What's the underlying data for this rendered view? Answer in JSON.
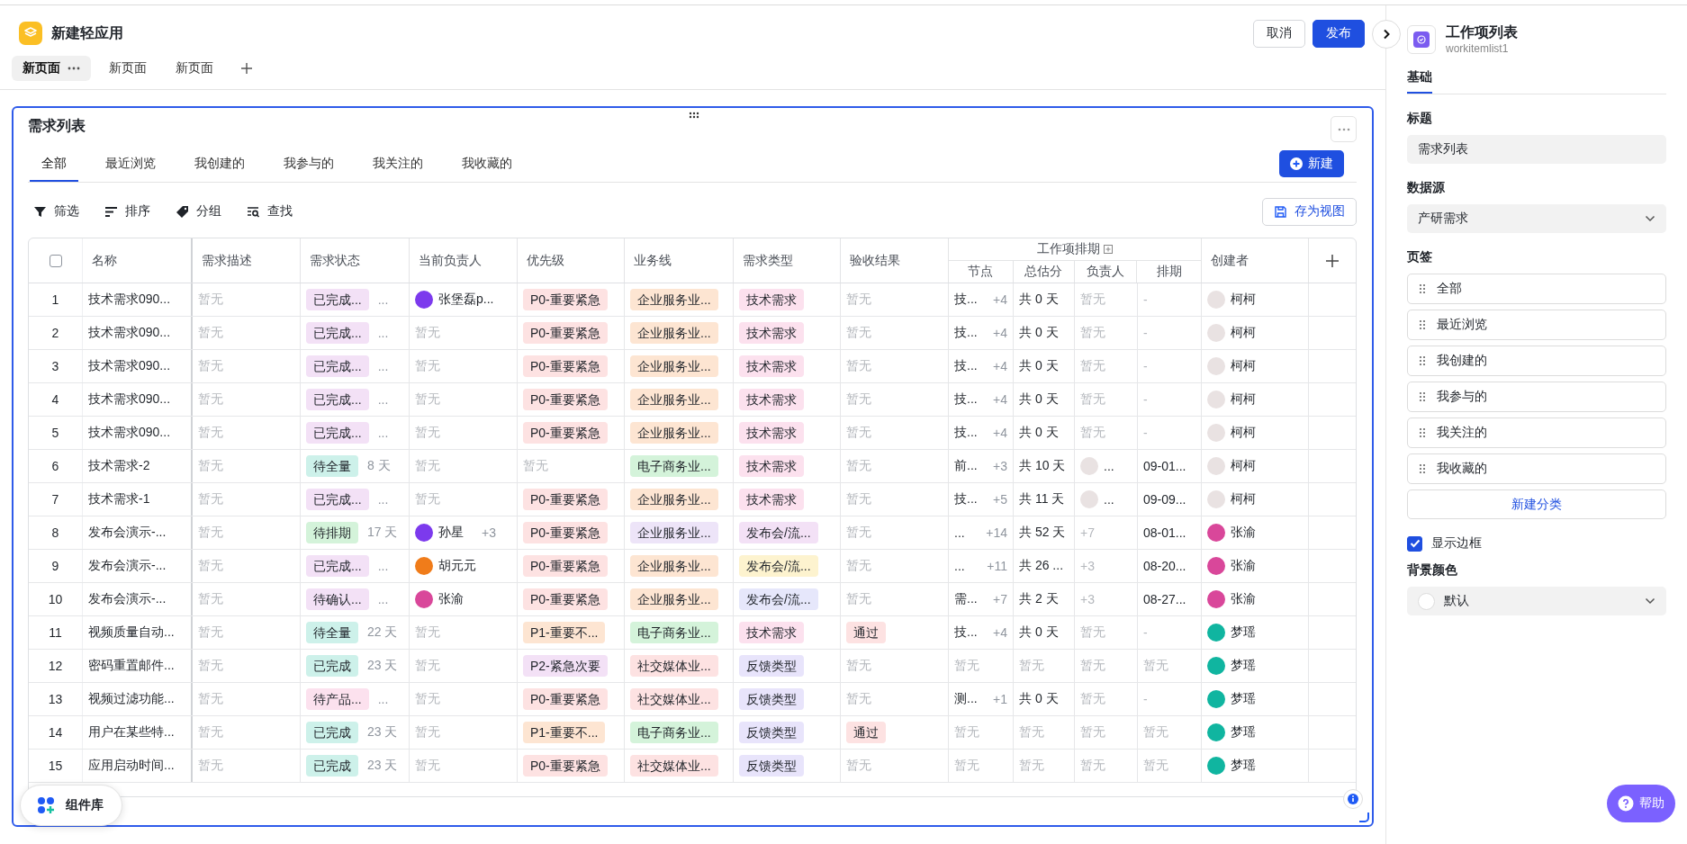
{
  "app": {
    "title": "新建轻应用"
  },
  "page_tabs": [
    {
      "label": "新页面",
      "selected": true
    },
    {
      "label": "新页面",
      "selected": false
    },
    {
      "label": "新页面",
      "selected": false
    }
  ],
  "header_buttons": [
    {
      "label": "取消",
      "kind": "secondary"
    },
    {
      "label": "发布",
      "kind": "primary"
    }
  ],
  "component": {
    "title": "需求列表",
    "tabs": [
      {
        "label": "全部",
        "selected": true
      },
      {
        "label": "最近浏览",
        "selected": false
      },
      {
        "label": "我创建的",
        "selected": false
      },
      {
        "label": "我参与的",
        "selected": false
      },
      {
        "label": "我关注的",
        "selected": false
      },
      {
        "label": "我收藏的",
        "selected": false
      }
    ],
    "new_button": "新建",
    "toolbar": [
      {
        "label": "筛选",
        "kind": "filter"
      },
      {
        "label": "排序",
        "kind": "sort"
      },
      {
        "label": "分组",
        "kind": "group"
      },
      {
        "label": "查找",
        "kind": "find"
      }
    ],
    "save_view_button": "存为视图",
    "table": {
      "columns": [
        {
          "kind": "select",
          "checked": false
        },
        {
          "label": "名称"
        },
        {
          "label": "需求描述"
        },
        {
          "label": "需求状态"
        },
        {
          "label": "当前负责人"
        },
        {
          "label": "优先级"
        },
        {
          "label": "业务线"
        },
        {
          "label": "需求类型"
        },
        {
          "label": "验收结果"
        },
        {
          "label": "节点"
        },
        {
          "label": "总估分"
        },
        {
          "label": "负责人"
        },
        {
          "label": "排期"
        },
        {
          "label": "创建者"
        }
      ],
      "column_groups": [
        {
          "label": "工作项排期"
        }
      ],
      "rows": [
        {
          "cells": [
            {
              "kind": "index",
              "text": "1"
            },
            {
              "kind": "text",
              "text": "技术需求090..."
            },
            {
              "kind": "muted",
              "text": "暂无"
            },
            {
              "kind": "tag",
              "text": "已完成...",
              "color": "#f3e1f6",
              "extra": "..."
            },
            {
              "kind": "person",
              "text": "张堡磊p...",
              "color": "#7c3aed"
            },
            {
              "kind": "tag",
              "text": "P0-重要紧急",
              "color": "#fde2e2"
            },
            {
              "kind": "tag",
              "text": "企业服务业...",
              "color": "#fde5d2"
            },
            {
              "kind": "tag",
              "text": "技术需求",
              "color": "#fce1ee"
            },
            {
              "kind": "muted",
              "text": "暂无"
            },
            {
              "kind": "text",
              "text": "技...",
              "extra": "+4"
            },
            {
              "kind": "text",
              "text": "共 0 天"
            },
            {
              "kind": "muted",
              "text": "暂无"
            },
            {
              "kind": "muted",
              "text": "-"
            },
            {
              "kind": "person",
              "text": "柯柯",
              "color": "#e9e2e2"
            }
          ]
        },
        {
          "cells": [
            {
              "kind": "index",
              "text": "2"
            },
            {
              "kind": "text",
              "text": "技术需求090..."
            },
            {
              "kind": "muted",
              "text": "暂无"
            },
            {
              "kind": "tag",
              "text": "已完成...",
              "color": "#f3e1f6",
              "extra": "..."
            },
            {
              "kind": "muted",
              "text": "暂无"
            },
            {
              "kind": "tag",
              "text": "P0-重要紧急",
              "color": "#fde2e2"
            },
            {
              "kind": "tag",
              "text": "企业服务业...",
              "color": "#fde5d2"
            },
            {
              "kind": "tag",
              "text": "技术需求",
              "color": "#fce1ee"
            },
            {
              "kind": "muted",
              "text": "暂无"
            },
            {
              "kind": "text",
              "text": "技...",
              "extra": "+4"
            },
            {
              "kind": "text",
              "text": "共 0 天"
            },
            {
              "kind": "muted",
              "text": "暂无"
            },
            {
              "kind": "muted",
              "text": "-"
            },
            {
              "kind": "person",
              "text": "柯柯",
              "color": "#e9e2e2"
            }
          ]
        },
        {
          "cells": [
            {
              "kind": "index",
              "text": "3"
            },
            {
              "kind": "text",
              "text": "技术需求090..."
            },
            {
              "kind": "muted",
              "text": "暂无"
            },
            {
              "kind": "tag",
              "text": "已完成...",
              "color": "#f3e1f6",
              "extra": "..."
            },
            {
              "kind": "muted",
              "text": "暂无"
            },
            {
              "kind": "tag",
              "text": "P0-重要紧急",
              "color": "#fde2e2"
            },
            {
              "kind": "tag",
              "text": "企业服务业...",
              "color": "#fde5d2"
            },
            {
              "kind": "tag",
              "text": "技术需求",
              "color": "#fce1ee"
            },
            {
              "kind": "muted",
              "text": "暂无"
            },
            {
              "kind": "text",
              "text": "技...",
              "extra": "+4"
            },
            {
              "kind": "text",
              "text": "共 0 天"
            },
            {
              "kind": "muted",
              "text": "暂无"
            },
            {
              "kind": "muted",
              "text": "-"
            },
            {
              "kind": "person",
              "text": "柯柯",
              "color": "#e9e2e2"
            }
          ]
        },
        {
          "cells": [
            {
              "kind": "index",
              "text": "4"
            },
            {
              "kind": "text",
              "text": "技术需求090..."
            },
            {
              "kind": "muted",
              "text": "暂无"
            },
            {
              "kind": "tag",
              "text": "已完成...",
              "color": "#f3e1f6",
              "extra": "..."
            },
            {
              "kind": "muted",
              "text": "暂无"
            },
            {
              "kind": "tag",
              "text": "P0-重要紧急",
              "color": "#fde2e2"
            },
            {
              "kind": "tag",
              "text": "企业服务业...",
              "color": "#fde5d2"
            },
            {
              "kind": "tag",
              "text": "技术需求",
              "color": "#fce1ee"
            },
            {
              "kind": "muted",
              "text": "暂无"
            },
            {
              "kind": "text",
              "text": "技...",
              "extra": "+4"
            },
            {
              "kind": "text",
              "text": "共 0 天"
            },
            {
              "kind": "muted",
              "text": "暂无"
            },
            {
              "kind": "muted",
              "text": "-"
            },
            {
              "kind": "person",
              "text": "柯柯",
              "color": "#e9e2e2"
            }
          ]
        },
        {
          "cells": [
            {
              "kind": "index",
              "text": "5"
            },
            {
              "kind": "text",
              "text": "技术需求090..."
            },
            {
              "kind": "muted",
              "text": "暂无"
            },
            {
              "kind": "tag",
              "text": "已完成...",
              "color": "#f3e1f6",
              "extra": "..."
            },
            {
              "kind": "muted",
              "text": "暂无"
            },
            {
              "kind": "tag",
              "text": "P0-重要紧急",
              "color": "#fde2e2"
            },
            {
              "kind": "tag",
              "text": "企业服务业...",
              "color": "#fde5d2"
            },
            {
              "kind": "tag",
              "text": "技术需求",
              "color": "#fce1ee"
            },
            {
              "kind": "muted",
              "text": "暂无"
            },
            {
              "kind": "text",
              "text": "技...",
              "extra": "+4"
            },
            {
              "kind": "text",
              "text": "共 0 天"
            },
            {
              "kind": "muted",
              "text": "暂无"
            },
            {
              "kind": "muted",
              "text": "-"
            },
            {
              "kind": "person",
              "text": "柯柯",
              "color": "#e9e2e2"
            }
          ]
        },
        {
          "cells": [
            {
              "kind": "index",
              "text": "6"
            },
            {
              "kind": "text",
              "text": "技术需求-2"
            },
            {
              "kind": "muted",
              "text": "暂无"
            },
            {
              "kind": "tag",
              "text": "待全量",
              "color": "#cdf1ea",
              "extra": "8 天"
            },
            {
              "kind": "muted",
              "text": "暂无"
            },
            {
              "kind": "muted",
              "text": "暂无"
            },
            {
              "kind": "tag",
              "text": "电子商务业...",
              "color": "#d4f3da"
            },
            {
              "kind": "tag",
              "text": "技术需求",
              "color": "#fce1ee"
            },
            {
              "kind": "muted",
              "text": "暂无"
            },
            {
              "kind": "text",
              "text": "前...",
              "extra": "+3"
            },
            {
              "kind": "text",
              "text": "共 10 天"
            },
            {
              "kind": "person",
              "text": "...",
              "color": "#e9e2e2"
            },
            {
              "kind": "text",
              "text": "09-01..."
            },
            {
              "kind": "person",
              "text": "柯柯",
              "color": "#e9e2e2"
            }
          ]
        },
        {
          "cells": [
            {
              "kind": "index",
              "text": "7"
            },
            {
              "kind": "text",
              "text": "技术需求-1"
            },
            {
              "kind": "muted",
              "text": "暂无"
            },
            {
              "kind": "tag",
              "text": "已完成...",
              "color": "#f3e1f6",
              "extra": "..."
            },
            {
              "kind": "muted",
              "text": "暂无"
            },
            {
              "kind": "tag",
              "text": "P0-重要紧急",
              "color": "#fde2e2"
            },
            {
              "kind": "tag",
              "text": "企业服务业...",
              "color": "#fde5d2"
            },
            {
              "kind": "tag",
              "text": "技术需求",
              "color": "#fce1ee"
            },
            {
              "kind": "muted",
              "text": "暂无"
            },
            {
              "kind": "text",
              "text": "技...",
              "extra": "+5"
            },
            {
              "kind": "text",
              "text": "共 11 天"
            },
            {
              "kind": "person",
              "text": "...",
              "color": "#e9e2e2"
            },
            {
              "kind": "text",
              "text": "09-09..."
            },
            {
              "kind": "person",
              "text": "柯柯",
              "color": "#e9e2e2"
            }
          ]
        },
        {
          "cells": [
            {
              "kind": "index",
              "text": "8"
            },
            {
              "kind": "text",
              "text": "发布会演示-..."
            },
            {
              "kind": "muted",
              "text": "暂无"
            },
            {
              "kind": "tag",
              "text": "待排期",
              "color": "#d4f3da",
              "extra": "17 天"
            },
            {
              "kind": "person",
              "text": "孙星",
              "color": "#7c3aed",
              "extra": "+3"
            },
            {
              "kind": "tag",
              "text": "P0-重要紧急",
              "color": "#fde2e2"
            },
            {
              "kind": "tag",
              "text": "企业服务业...",
              "color": "#ede4f8"
            },
            {
              "kind": "tag",
              "text": "发布会/流...",
              "color": "#f3e1f6"
            },
            {
              "kind": "muted",
              "text": "暂无"
            },
            {
              "kind": "text",
              "text": "...",
              "extra": "+14"
            },
            {
              "kind": "text",
              "text": "共 52 天"
            },
            {
              "kind": "muted",
              "text": "+7"
            },
            {
              "kind": "text",
              "text": "08-01..."
            },
            {
              "kind": "person",
              "text": "张渝",
              "color": "#d9479a"
            }
          ]
        },
        {
          "cells": [
            {
              "kind": "index",
              "text": "9"
            },
            {
              "kind": "text",
              "text": "发布会演示-..."
            },
            {
              "kind": "muted",
              "text": "暂无"
            },
            {
              "kind": "tag",
              "text": "已完成...",
              "color": "#f3e1f6",
              "extra": "..."
            },
            {
              "kind": "person",
              "text": "胡元元",
              "color": "#f07c1a"
            },
            {
              "kind": "tag",
              "text": "P0-重要紧急",
              "color": "#fde2e2"
            },
            {
              "kind": "tag",
              "text": "企业服务业...",
              "color": "#fde5d2"
            },
            {
              "kind": "tag",
              "text": "发布会/流...",
              "color": "#fdf3cf"
            },
            {
              "kind": "muted",
              "text": "暂无"
            },
            {
              "kind": "text",
              "text": "...",
              "extra": "+11"
            },
            {
              "kind": "text",
              "text": "共 26 ..."
            },
            {
              "kind": "muted",
              "text": "+3"
            },
            {
              "kind": "text",
              "text": "08-20..."
            },
            {
              "kind": "person",
              "text": "张渝",
              "color": "#d9479a"
            }
          ]
        },
        {
          "cells": [
            {
              "kind": "index",
              "text": "10"
            },
            {
              "kind": "text",
              "text": "发布会演示-..."
            },
            {
              "kind": "muted",
              "text": "暂无"
            },
            {
              "kind": "tag",
              "text": "待确认...",
              "color": "#f3e1f6",
              "extra": "..."
            },
            {
              "kind": "person",
              "text": "张渝",
              "color": "#d9479a"
            },
            {
              "kind": "tag",
              "text": "P0-重要紧急",
              "color": "#fde2e2"
            },
            {
              "kind": "tag",
              "text": "企业服务业...",
              "color": "#fde5d2"
            },
            {
              "kind": "tag",
              "text": "发布会/流...",
              "color": "#e6e7fb"
            },
            {
              "kind": "muted",
              "text": "暂无"
            },
            {
              "kind": "text",
              "text": "需...",
              "extra": "+7"
            },
            {
              "kind": "text",
              "text": "共 2 天"
            },
            {
              "kind": "muted",
              "text": "+3"
            },
            {
              "kind": "text",
              "text": "08-27..."
            },
            {
              "kind": "person",
              "text": "张渝",
              "color": "#d9479a"
            }
          ]
        },
        {
          "cells": [
            {
              "kind": "index",
              "text": "11"
            },
            {
              "kind": "text",
              "text": "视频质量自动..."
            },
            {
              "kind": "muted",
              "text": "暂无"
            },
            {
              "kind": "tag",
              "text": "待全量",
              "color": "#cdf1ea",
              "extra": "22 天"
            },
            {
              "kind": "muted",
              "text": "暂无"
            },
            {
              "kind": "tag",
              "text": "P1-重要不...",
              "color": "#fde5d2"
            },
            {
              "kind": "tag",
              "text": "电子商务业...",
              "color": "#d4f3da"
            },
            {
              "kind": "tag",
              "text": "技术需求",
              "color": "#fce1ee"
            },
            {
              "kind": "tag",
              "text": "通过",
              "color": "#fde2e2"
            },
            {
              "kind": "text",
              "text": "技...",
              "extra": "+4"
            },
            {
              "kind": "text",
              "text": "共 0 天"
            },
            {
              "kind": "muted",
              "text": "暂无"
            },
            {
              "kind": "muted",
              "text": "-"
            },
            {
              "kind": "person",
              "text": "梦瑶",
              "color": "#10b5a0"
            }
          ]
        },
        {
          "cells": [
            {
              "kind": "index",
              "text": "12"
            },
            {
              "kind": "text",
              "text": "密码重置邮件..."
            },
            {
              "kind": "muted",
              "text": "暂无"
            },
            {
              "kind": "tag",
              "text": "已完成",
              "color": "#cdf1ea",
              "extra": "23 天"
            },
            {
              "kind": "muted",
              "text": "暂无"
            },
            {
              "kind": "tag",
              "text": "P2-紧急次要",
              "color": "#f3e1f6"
            },
            {
              "kind": "tag",
              "text": "社交媒体业...",
              "color": "#fde2e2"
            },
            {
              "kind": "tag",
              "text": "反馈类型",
              "color": "#e8e4fb"
            },
            {
              "kind": "muted",
              "text": "暂无"
            },
            {
              "kind": "muted",
              "text": "暂无"
            },
            {
              "kind": "muted",
              "text": "暂无"
            },
            {
              "kind": "muted",
              "text": "暂无"
            },
            {
              "kind": "muted",
              "text": "暂无"
            },
            {
              "kind": "person",
              "text": "梦瑶",
              "color": "#10b5a0"
            }
          ]
        },
        {
          "cells": [
            {
              "kind": "index",
              "text": "13"
            },
            {
              "kind": "text",
              "text": "视频过滤功能..."
            },
            {
              "kind": "muted",
              "text": "暂无"
            },
            {
              "kind": "tag",
              "text": "待产品...",
              "color": "#fce1ee",
              "extra": "..."
            },
            {
              "kind": "muted",
              "text": "暂无"
            },
            {
              "kind": "tag",
              "text": "P0-重要紧急",
              "color": "#fde2e2"
            },
            {
              "kind": "tag",
              "text": "社交媒体业...",
              "color": "#fde2e2"
            },
            {
              "kind": "tag",
              "text": "反馈类型",
              "color": "#e8e4fb"
            },
            {
              "kind": "muted",
              "text": "暂无"
            },
            {
              "kind": "text",
              "text": "测...",
              "extra": "+1"
            },
            {
              "kind": "text",
              "text": "共 0 天"
            },
            {
              "kind": "muted",
              "text": "暂无"
            },
            {
              "kind": "muted",
              "text": "-"
            },
            {
              "kind": "person",
              "text": "梦瑶",
              "color": "#10b5a0"
            }
          ]
        },
        {
          "cells": [
            {
              "kind": "index",
              "text": "14"
            },
            {
              "kind": "text",
              "text": "用户在某些特..."
            },
            {
              "kind": "muted",
              "text": "暂无"
            },
            {
              "kind": "tag",
              "text": "已完成",
              "color": "#cdf1ea",
              "extra": "23 天"
            },
            {
              "kind": "muted",
              "text": "暂无"
            },
            {
              "kind": "tag",
              "text": "P1-重要不...",
              "color": "#fde5d2"
            },
            {
              "kind": "tag",
              "text": "电子商务业...",
              "color": "#d4f3da"
            },
            {
              "kind": "tag",
              "text": "反馈类型",
              "color": "#e8e4fb"
            },
            {
              "kind": "tag",
              "text": "通过",
              "color": "#fde2e2"
            },
            {
              "kind": "muted",
              "text": "暂无"
            },
            {
              "kind": "muted",
              "text": "暂无"
            },
            {
              "kind": "muted",
              "text": "暂无"
            },
            {
              "kind": "muted",
              "text": "暂无"
            },
            {
              "kind": "person",
              "text": "梦瑶",
              "color": "#10b5a0"
            }
          ]
        },
        {
          "cells": [
            {
              "kind": "index",
              "text": "15"
            },
            {
              "kind": "text",
              "text": "应用启动时间..."
            },
            {
              "kind": "muted",
              "text": "暂无"
            },
            {
              "kind": "tag",
              "text": "已完成",
              "color": "#cdf1ea",
              "extra": "23 天"
            },
            {
              "kind": "muted",
              "text": "暂无"
            },
            {
              "kind": "tag",
              "text": "P0-重要紧急",
              "color": "#fde2e2"
            },
            {
              "kind": "tag",
              "text": "社交媒体业...",
              "color": "#fde2e2"
            },
            {
              "kind": "tag",
              "text": "反馈类型",
              "color": "#e8e4fb"
            },
            {
              "kind": "muted",
              "text": "暂无"
            },
            {
              "kind": "muted",
              "text": "暂无"
            },
            {
              "kind": "muted",
              "text": "暂无"
            },
            {
              "kind": "muted",
              "text": "暂无"
            },
            {
              "kind": "muted",
              "text": "暂无"
            },
            {
              "kind": "person",
              "text": "梦瑶",
              "color": "#10b5a0"
            }
          ]
        }
      ]
    }
  },
  "floating": {
    "library_button": "组件库",
    "help_button": "帮助"
  },
  "panel": {
    "title": "工作项列表",
    "subtitle": "workitemlist1",
    "tabs": [
      {
        "label": "基础",
        "selected": true
      }
    ],
    "title_field": {
      "label": "标题",
      "value": "需求列表"
    },
    "source_field": {
      "label": "数据源",
      "value": "产研需求"
    },
    "tabs_section": {
      "label": "页签",
      "items": [
        "全部",
        "最近浏览",
        "我创建的",
        "我参与的",
        "我关注的",
        "我收藏的"
      ],
      "add_button": "新建分类"
    },
    "show_border": {
      "label": "显示边框",
      "checked": true
    },
    "background_field": {
      "label": "背景颜色",
      "value": "默认"
    }
  }
}
